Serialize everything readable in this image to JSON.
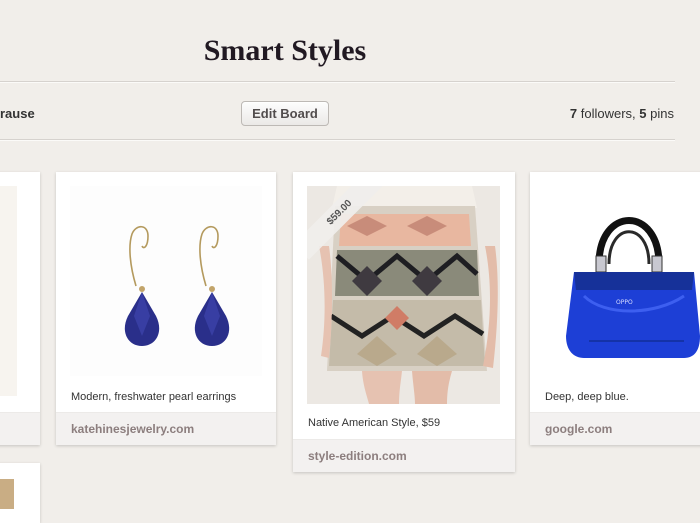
{
  "board": {
    "title": "Smart Styles",
    "owner": "rause",
    "edit_label": "Edit Board",
    "followers_count": "7",
    "followers_label": "followers,",
    "pins_count": "5",
    "pins_label": "pins"
  },
  "pins": [
    {
      "description": "Modern, freshwater pearl earrings",
      "source": "katehinesjewelry.com"
    },
    {
      "description": "Native American Style, $59",
      "source": "style-edition.com",
      "price": "$59.00"
    },
    {
      "description": "Deep, deep blue.",
      "source": "google.com"
    }
  ],
  "colors": {
    "background": "#f1eeea",
    "bag_blue": "#1d3fd6",
    "earring_blue": "#2a2f8a"
  }
}
